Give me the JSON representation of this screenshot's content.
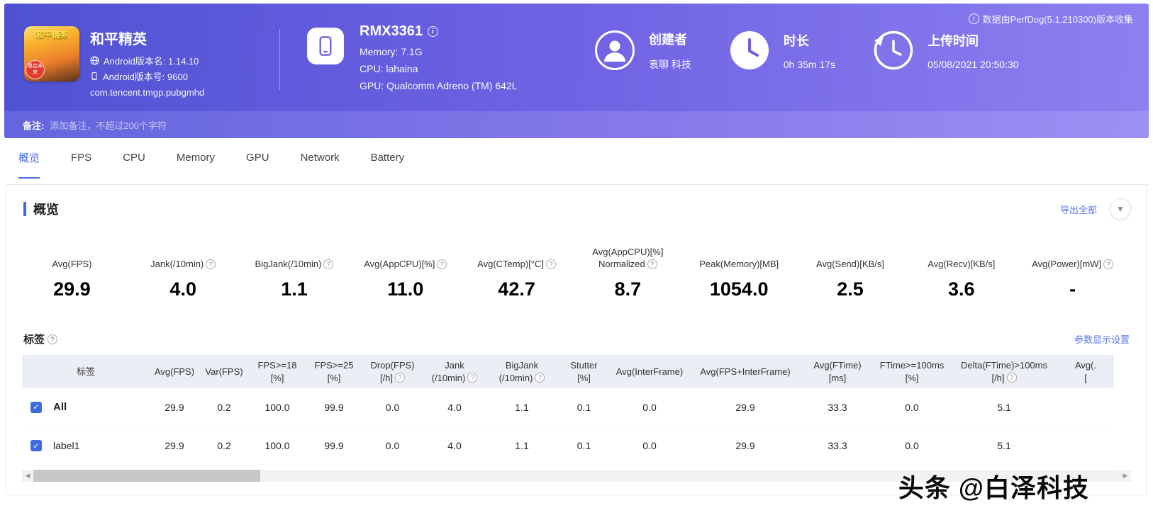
{
  "watermark": "头条 @白泽科技",
  "header": {
    "collect_info": "数据由PerfDog(5.1.210300)版本收集",
    "app": {
      "name": "和平精英",
      "icon_title": "和平精英",
      "icon_badge": "重启未来",
      "version_name": "Android版本名: 1.14.10",
      "version_code": "Android版本号: 9600",
      "package": "com.tencent.tmgp.pubgmhd"
    },
    "device": {
      "model": "RMX3361",
      "memory": "Memory: 7.1G",
      "cpu": "CPU: lahaina",
      "gpu": "GPU: Qualcomm Adreno (TM) 642L"
    },
    "creator": {
      "label": "创建者",
      "value": "袁聊 科技"
    },
    "duration": {
      "label": "时长",
      "value": "0h 35m 17s"
    },
    "upload_time": {
      "label": "上传时间",
      "value": "05/08/2021 20:50:30"
    },
    "remark": {
      "label": "备注:",
      "placeholder": "添加备注，不超过200个字符"
    }
  },
  "tabs": [
    {
      "label": "概览",
      "active": true
    },
    {
      "label": "FPS",
      "active": false
    },
    {
      "label": "CPU",
      "active": false
    },
    {
      "label": "Memory",
      "active": false
    },
    {
      "label": "GPU",
      "active": false
    },
    {
      "label": "Network",
      "active": false
    },
    {
      "label": "Battery",
      "active": false
    }
  ],
  "overview": {
    "title": "概览",
    "export_label": "导出全部",
    "metrics": [
      {
        "lines": [
          "Avg(FPS)"
        ],
        "help": false,
        "value": "29.9"
      },
      {
        "lines": [
          "Jank(/10min)"
        ],
        "help": true,
        "value": "4.0"
      },
      {
        "lines": [
          "BigJank(/10min)"
        ],
        "help": true,
        "value": "1.1"
      },
      {
        "lines": [
          "Avg(AppCPU)[%]"
        ],
        "help": true,
        "value": "11.0"
      },
      {
        "lines": [
          "Avg(CTemp)[°C]"
        ],
        "help": true,
        "value": "42.7"
      },
      {
        "lines": [
          "Avg(AppCPU)[%]",
          "Normalized"
        ],
        "help": true,
        "value": "8.7"
      },
      {
        "lines": [
          "Peak(Memory)[MB]"
        ],
        "help": false,
        "value": "1054.0"
      },
      {
        "lines": [
          "Avg(Send)[KB/s]"
        ],
        "help": false,
        "value": "2.5"
      },
      {
        "lines": [
          "Avg(Recv)[KB/s]"
        ],
        "help": false,
        "value": "3.6"
      },
      {
        "lines": [
          "Avg(Power)[mW]"
        ],
        "help": true,
        "value": "-"
      }
    ]
  },
  "labels_section": {
    "title": "标签",
    "settings_label": "参数显示设置",
    "table": {
      "headers": [
        {
          "lines": [
            "标签"
          ],
          "help": false
        },
        {
          "lines": [
            "Avg(FPS)"
          ],
          "help": false
        },
        {
          "lines": [
            "Var(FPS)"
          ],
          "help": false
        },
        {
          "lines": [
            "FPS>=18",
            "[%]"
          ],
          "help": false
        },
        {
          "lines": [
            "FPS>=25",
            "[%]"
          ],
          "help": false
        },
        {
          "lines": [
            "Drop(FPS)",
            "[/h]"
          ],
          "help": true
        },
        {
          "lines": [
            "Jank",
            "(/10min)"
          ],
          "help": true
        },
        {
          "lines": [
            "BigJank",
            "(/10min)"
          ],
          "help": true
        },
        {
          "lines": [
            "Stutter",
            "[%]"
          ],
          "help": false
        },
        {
          "lines": [
            "Avg(InterFrame)"
          ],
          "help": false
        },
        {
          "lines": [
            "Avg(FPS+InterFrame)"
          ],
          "help": false
        },
        {
          "lines": [
            "Avg(FTime)",
            "[ms]"
          ],
          "help": false
        },
        {
          "lines": [
            "FTime>=100ms",
            "[%]"
          ],
          "help": false
        },
        {
          "lines": [
            "Delta(FTime)>100ms",
            "[/h]"
          ],
          "help": true
        },
        {
          "lines": [
            "Avg(.",
            "["
          ],
          "help": false
        }
      ],
      "rows": [
        {
          "checked": true,
          "name": "All",
          "bold": true,
          "values": [
            "29.9",
            "0.2",
            "100.0",
            "99.9",
            "0.0",
            "4.0",
            "1.1",
            "0.1",
            "0.0",
            "29.9",
            "33.3",
            "0.0",
            "5.1",
            ""
          ]
        },
        {
          "checked": true,
          "name": "label1",
          "bold": false,
          "values": [
            "29.9",
            "0.2",
            "100.0",
            "99.9",
            "0.0",
            "4.0",
            "1.1",
            "0.1",
            "0.0",
            "29.9",
            "33.3",
            "0.0",
            "5.1",
            ""
          ]
        }
      ]
    }
  }
}
